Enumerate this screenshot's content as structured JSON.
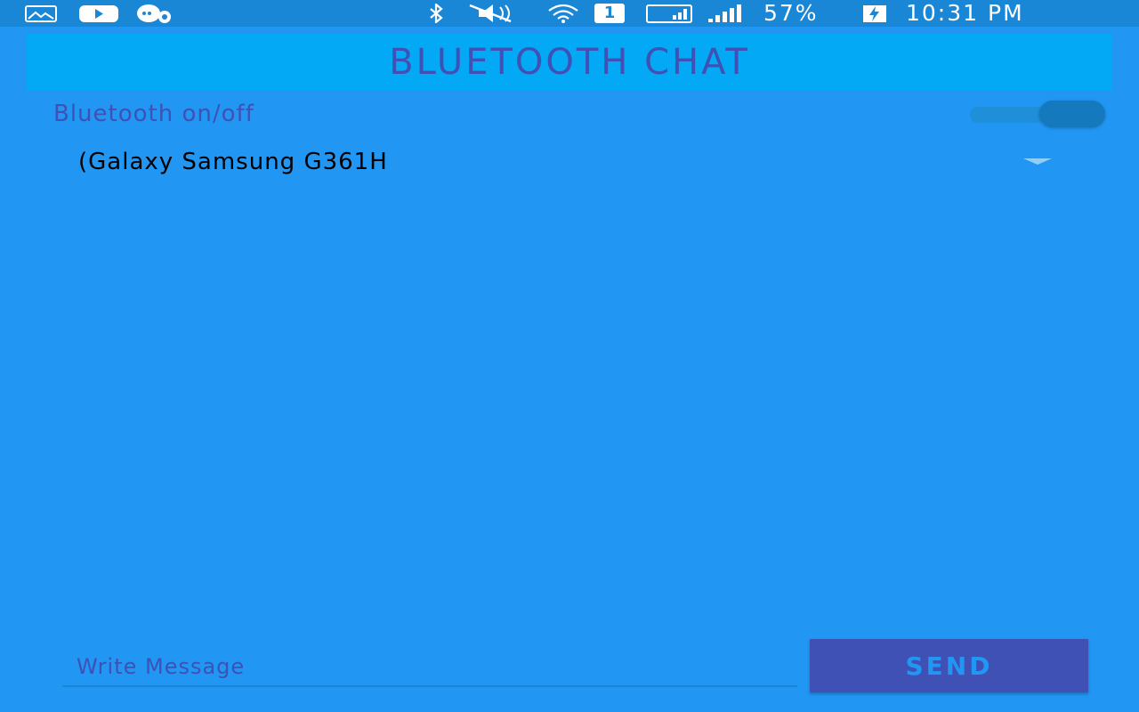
{
  "status_bar": {
    "battery": "57%",
    "time": "10:31 PM",
    "sim_slot": "1",
    "icons_left": [
      "gallery-icon",
      "youtube-icon",
      "chat-notification-icon"
    ],
    "icons_right": [
      "bluetooth-icon",
      "mute-icon",
      "wifi-icon",
      "sim-icon",
      "signal-box-icon",
      "signal-bars-icon",
      "battery-icon"
    ]
  },
  "header": {
    "title": "BLUETOOTH CHAT"
  },
  "bluetooth_toggle": {
    "label": "Bluetooth on/off",
    "state": "on"
  },
  "device_spinner": {
    "selected": "(Galaxy Samsung G361H"
  },
  "composer": {
    "placeholder": "Write Message",
    "value": "",
    "send_label": "SEND"
  },
  "colors": {
    "background": "#2196F3",
    "status_bar": "#1A86D6",
    "title_bar": "#03A9F4",
    "primary_text": "#3F51B5",
    "button": "#3F51B5"
  }
}
